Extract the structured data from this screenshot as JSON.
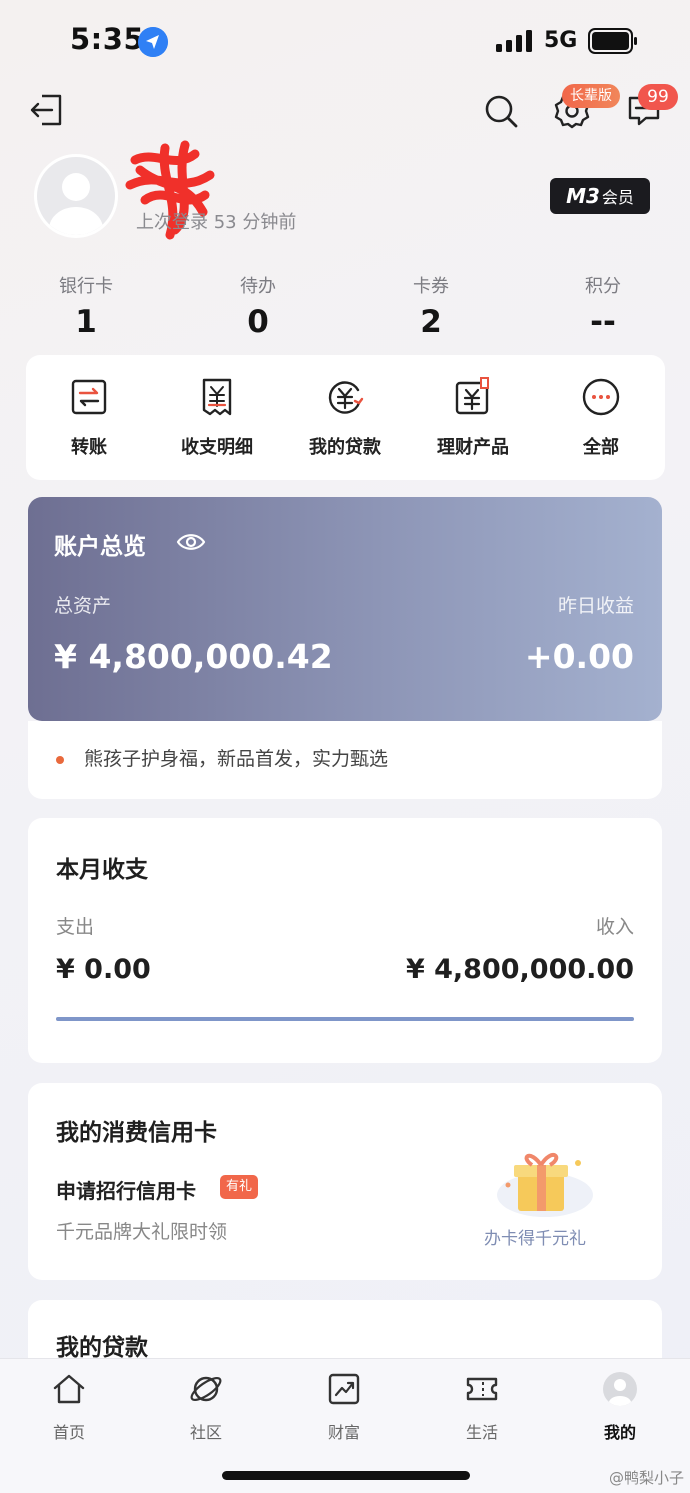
{
  "status_bar": {
    "time": "5:35",
    "network": "5G"
  },
  "header": {
    "elder_badge": "长辈版",
    "message_count": "99"
  },
  "profile": {
    "last_login": "上次登录 53 分钟前",
    "member_level": "M3",
    "member_suffix": "会员"
  },
  "stats": [
    {
      "label": "银行卡",
      "value": "1"
    },
    {
      "label": "待办",
      "value": "0"
    },
    {
      "label": "卡券",
      "value": "2"
    },
    {
      "label": "积分",
      "value": "--"
    }
  ],
  "shortcuts": [
    {
      "label": "转账",
      "icon": "transfer-icon"
    },
    {
      "label": "收支明细",
      "icon": "bill-icon"
    },
    {
      "label": "我的贷款",
      "icon": "loan-icon"
    },
    {
      "label": "理财产品",
      "icon": "wealth-icon"
    },
    {
      "label": "全部",
      "icon": "more-icon"
    }
  ],
  "overview": {
    "title": "账户总览",
    "total_assets_label": "总资产",
    "total_assets_value": "¥ 4,800,000.42",
    "yesterday_label": "昨日收益",
    "yesterday_value": "+0.00",
    "promo_text": "熊孩子护身福，新品首发，实力甄选"
  },
  "monthly": {
    "title": "本月收支",
    "expense_label": "支出",
    "expense_value": "¥ 0.00",
    "income_label": "收入",
    "income_value": "¥ 4,800,000.00",
    "income_share": 1.0
  },
  "credit_card": {
    "title": "我的消费信用卡",
    "apply_label": "申请招行信用卡",
    "gift_badge": "有礼",
    "subtitle": "千元品牌大礼限时领",
    "gift_caption": "办卡得千元礼"
  },
  "loans": {
    "title": "我的贷款"
  },
  "tabs": [
    {
      "label": "首页",
      "icon": "home-icon"
    },
    {
      "label": "社区",
      "icon": "planet-icon"
    },
    {
      "label": "财富",
      "icon": "chart-icon"
    },
    {
      "label": "生活",
      "icon": "ticket-icon"
    },
    {
      "label": "我的",
      "icon": "avatar-icon",
      "active": true
    }
  ],
  "watermark": "@鸭梨小子",
  "colors": {
    "accent": "#f1674a",
    "overview_start": "#6e6f92",
    "overview_end": "#a4b1cf",
    "bar": "#7f96c9"
  }
}
